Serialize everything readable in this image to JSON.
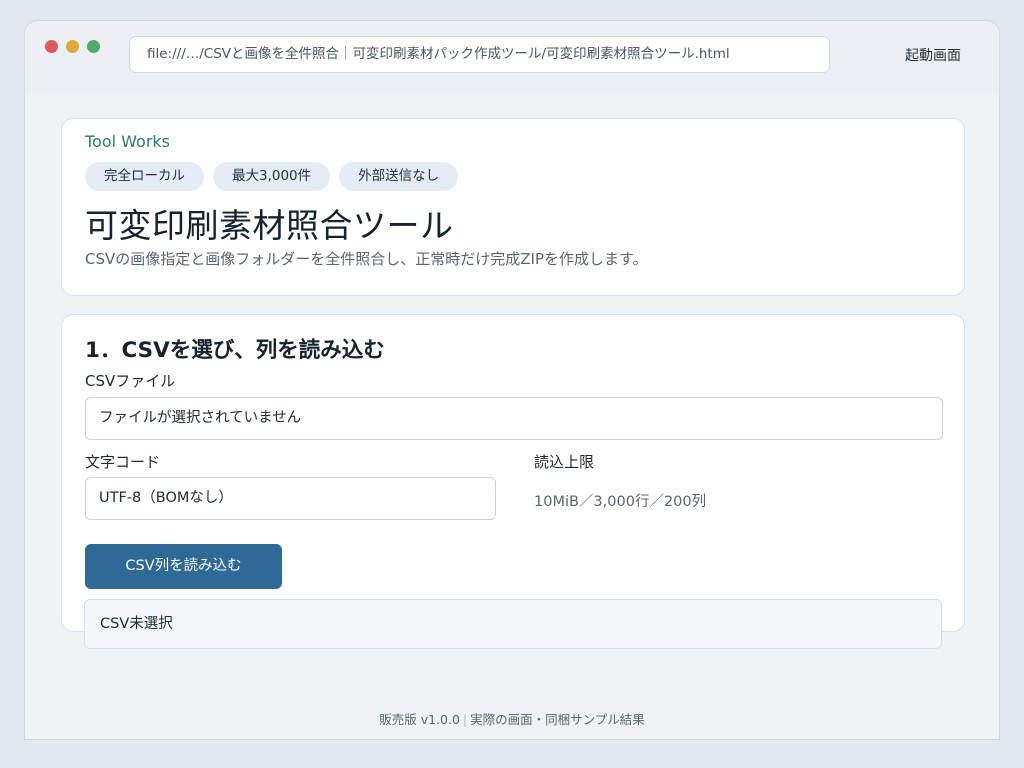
{
  "browser": {
    "url": "file:///…/CSVと画像を全件照合｜可変印刷素材パック作成ツール/可変印刷素材照合ツール.html",
    "launch_label": "起動画面"
  },
  "hero": {
    "brand": "Tool Works",
    "badges": [
      "完全ローカル",
      "最大3,000件",
      "外部送信なし"
    ],
    "title": "可変印刷素材照合ツール",
    "description": "CSVの画像指定と画像フォルダーを全件照合し、正常時だけ完成ZIPを作成します。"
  },
  "step1": {
    "title": "1．CSVを選び、列を読み込む",
    "csv_file_label": "CSVファイル",
    "csv_file_value": "ファイルが選択されていません",
    "encoding_label": "文字コード",
    "encoding_value": "UTF-8（BOMなし）",
    "limit_label": "読込上限",
    "limit_value": "10MiB／3,000行／200列",
    "load_button": "CSV列を読み込む",
    "status": "CSV未選択"
  },
  "footer": {
    "version": "販売版 v1.0.0",
    "note": "実際の画面・同梱サンプル結果"
  },
  "colors": {
    "brand": "#2f7a71",
    "primary_button": "#2f6a96",
    "badge_bg": "#e4ecf5",
    "traffic_red": "#de5b5b",
    "traffic_yellow": "#e0a93b",
    "traffic_green": "#53a86a"
  }
}
